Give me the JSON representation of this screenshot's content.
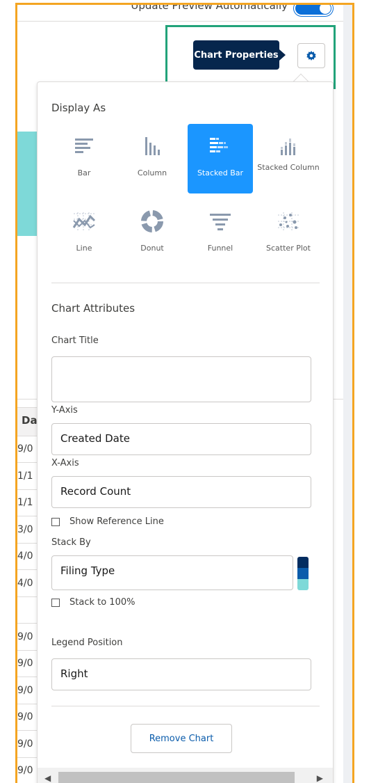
{
  "header": {
    "toggle_label": "Update Preview Automatically",
    "tooltip": "Chart Properties"
  },
  "colors": {
    "accent": "#1b96ff",
    "tooltip_bg": "#06264d",
    "highlight": "#22a37a",
    "frame": "#f4a522",
    "teal": "#7ed9d8",
    "navy": "#032d60"
  },
  "background_table": {
    "header_fragment": "Da",
    "rows": [
      "9/0",
      "1/1",
      "1/1",
      "3/0",
      "4/0",
      "4/0",
      "",
      "9/0",
      "9/0",
      "9/0",
      "9/0",
      "9/0",
      "9/0"
    ]
  },
  "display_as": {
    "title": "Display As",
    "types": [
      {
        "label": "Bar",
        "icon": "bar-chart-icon",
        "selected": false
      },
      {
        "label": "Column",
        "icon": "column-chart-icon",
        "selected": false
      },
      {
        "label": "Stacked Bar",
        "icon": "stacked-bar-chart-icon",
        "selected": true
      },
      {
        "label": "Stacked Column",
        "icon": "stacked-column-chart-icon",
        "selected": false
      },
      {
        "label": "Line",
        "icon": "line-chart-icon",
        "selected": false
      },
      {
        "label": "Donut",
        "icon": "donut-chart-icon",
        "selected": false
      },
      {
        "label": "Funnel",
        "icon": "funnel-chart-icon",
        "selected": false
      },
      {
        "label": "Scatter Plot",
        "icon": "scatter-plot-icon",
        "selected": false
      }
    ]
  },
  "attributes": {
    "title": "Chart Attributes",
    "chart_title_label": "Chart Title",
    "chart_title_value": "",
    "y_axis_label": "Y-Axis",
    "y_axis_value": "Created Date",
    "x_axis_label": "X-Axis",
    "x_axis_value": "Record Count",
    "show_reference_line": "Show Reference Line",
    "stack_by_label": "Stack By",
    "stack_by_value": "Filing Type",
    "stack_to_100": "Stack to 100%",
    "legend_position_label": "Legend Position",
    "legend_position_value": "Right",
    "remove_chart": "Remove Chart"
  }
}
